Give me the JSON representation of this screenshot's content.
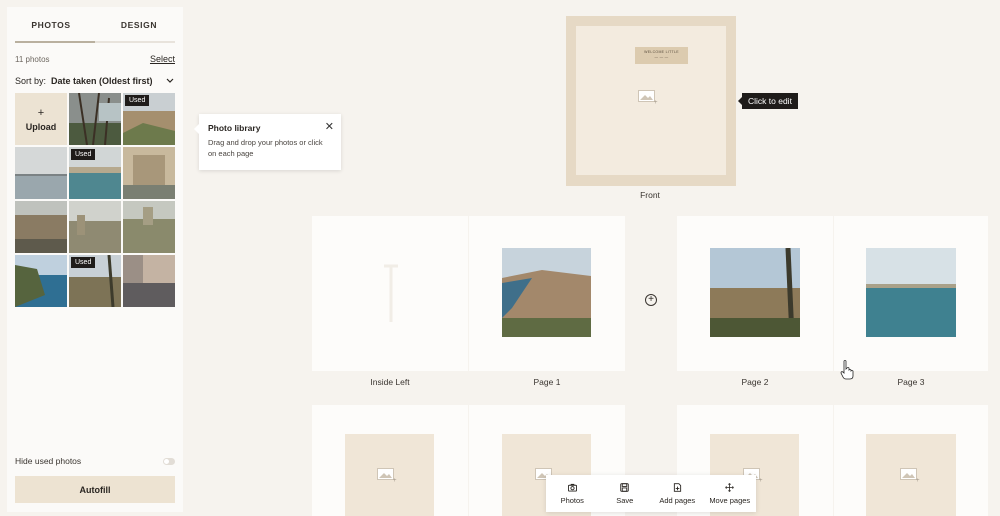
{
  "sidebar": {
    "tabs": [
      {
        "label": "PHOTOS"
      },
      {
        "label": "DESIGN"
      }
    ],
    "photo_count": "11 photos",
    "select_label": "Select",
    "sort_label": "Sort by:",
    "sort_value": "Date taken (Oldest first)",
    "upload_label": "Upload",
    "upload_plus": "+",
    "used_badge": "Used",
    "hide_used_label": "Hide used photos",
    "autofill_label": "Autofill"
  },
  "tooltip": {
    "title": "Photo library",
    "body": "Drag and drop your photos or click on each page",
    "close": "✕"
  },
  "cover": {
    "label_line1": "WELCOME LITTLE",
    "label_line2": "— — —",
    "caption": "Front",
    "hint": "Click to edit"
  },
  "pages": {
    "inside_left": "Inside Left",
    "page1": "Page 1",
    "page2": "Page 2",
    "page3": "Page 3",
    "add_symbol": "+"
  },
  "toolbar": {
    "photos": "Photos",
    "save": "Save",
    "add_pages": "Add pages",
    "move_pages": "Move pages"
  },
  "colors": {
    "accent": "#ece3d3",
    "cover": "#e6d9c5",
    "badge": "#1f1c1a"
  }
}
